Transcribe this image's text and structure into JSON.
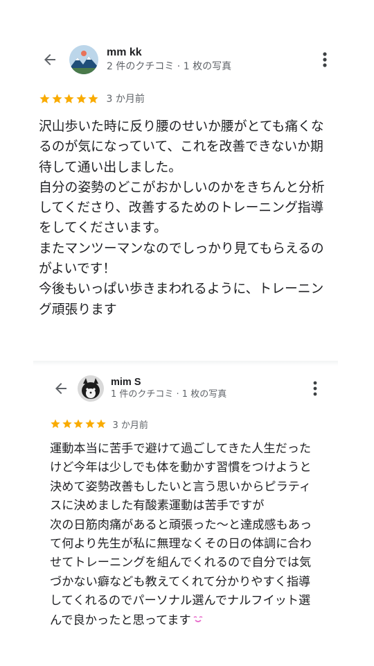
{
  "reviews": [
    {
      "name": "mm kk",
      "meta": "2 件のクチコミ · 1 枚の写真",
      "rating": 5,
      "time": "3 か月前",
      "avatar_icon": "mountain-landscape-avatar",
      "lines": [
        "沢山歩いた時に反り腰のせいか腰がとても痛くな",
        "るのが気になっていて、これを改善できないか期",
        "待して通い出しました。",
        "自分の姿勢のどこがおかしいのかをきちんと分析",
        "してくださり、改善するためのトレーニング指導",
        "をしてくださいます。",
        "またマンツーマンなのでしっかり見てもらえるの",
        "がよいです！",
        "今後もいっぱい歩きまわれるように、トレーニン",
        "グ頑張ります"
      ]
    },
    {
      "name": "mim S",
      "meta": "1 件のクチコミ · 1 枚の写真",
      "rating": 5,
      "time": "3 か月前",
      "avatar_icon": "pet-dog-avatar",
      "lines": [
        "運動本当に苦手で避けて過ごしてきた人生だった",
        "けど今年は少しでも体を動かす習慣をつけようと",
        "決めて姿勢改善もしたいと言う思いからピラティ",
        "スに決めました有酸素運動は苦手ですが",
        "次の日筋肉痛があると頑張った〜と達成感もあっ",
        "て何より先生が私に無理なくその日の体調に合わ",
        "せてトレーニングを組んでくれるので自分では気",
        "づかない癖なども教えてくれて分かりやすく指導",
        "してくれるのでパーソナル選んでナルフイット選",
        "んで良かったと思ってます"
      ],
      "trailing_emoji": "smiling-face-icon"
    }
  ],
  "colors": {
    "star": "#f9ab00",
    "text": "#202124",
    "secondary": "#5f6368",
    "emoji": "#e667c9"
  }
}
